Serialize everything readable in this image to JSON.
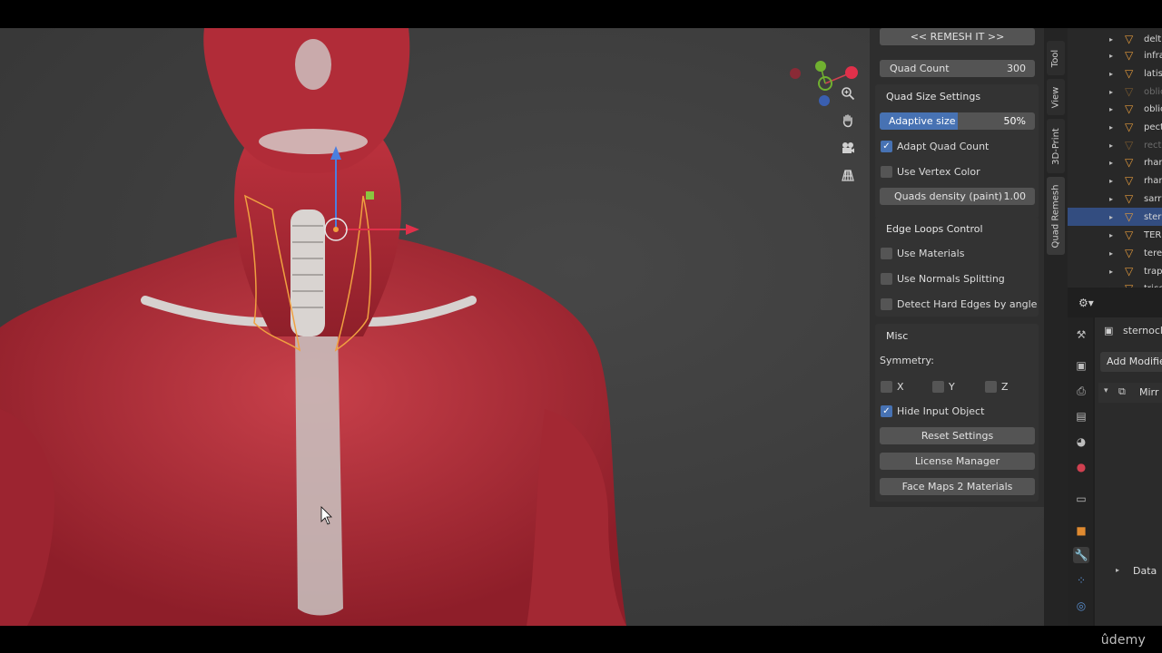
{
  "watermark": "ûdemy",
  "npanel": {
    "remesh_button": "<< REMESH IT >>",
    "quad_count": {
      "label": "Quad Count",
      "value": "300"
    },
    "quad_size": {
      "title": "Quad Size Settings",
      "adaptive": {
        "label": "Adaptive size",
        "value": "50%",
        "fraction": 0.5
      },
      "adapt_quad_count": {
        "label": "Adapt Quad Count",
        "checked": true
      },
      "use_vertex_color": {
        "label": "Use Vertex Color",
        "checked": false
      },
      "quads_density": {
        "label": "Quads density (paint)",
        "value": "1.00"
      }
    },
    "edge_loops": {
      "title": "Edge Loops Control",
      "use_materials": {
        "label": "Use Materials",
        "checked": false
      },
      "use_normals": {
        "label": "Use Normals Splitting",
        "checked": false
      },
      "detect_hard": {
        "label": "Detect Hard Edges by angle",
        "checked": false
      }
    },
    "misc": {
      "title": "Misc",
      "symmetry_label": "Symmetry:",
      "sym_x": "X",
      "sym_y": "Y",
      "sym_z": "Z",
      "hide_input": {
        "label": "Hide Input Object",
        "checked": true
      },
      "reset": "Reset Settings",
      "license": "License Manager",
      "face_maps": "Face Maps 2 Materials"
    }
  },
  "vtabs": [
    "Tool",
    "View",
    "3D-Print",
    "Quad Remesh"
  ],
  "outliner": [
    {
      "name": "delt",
      "state": "normal"
    },
    {
      "name": "infra",
      "state": "normal"
    },
    {
      "name": "latis",
      "state": "normal"
    },
    {
      "name": "oblic",
      "state": "dim"
    },
    {
      "name": "oblic",
      "state": "normal"
    },
    {
      "name": "pect",
      "state": "normal"
    },
    {
      "name": "rect",
      "state": "dim"
    },
    {
      "name": "rhar",
      "state": "normal"
    },
    {
      "name": "rhar",
      "state": "normal"
    },
    {
      "name": "sarr",
      "state": "normal"
    },
    {
      "name": "ster",
      "state": "selected"
    },
    {
      "name": "TER",
      "state": "normal"
    },
    {
      "name": "tere",
      "state": "normal"
    },
    {
      "name": "trap",
      "state": "normal"
    },
    {
      "name": "trice",
      "state": "normal"
    }
  ],
  "properties": {
    "object_name": "sternocl",
    "add_modifier": "Add Modifier",
    "modifier_name": "Mirr",
    "data_label": "Data"
  },
  "icons": {
    "zoom": "zoom-icon",
    "hand": "pan-icon",
    "camera": "camera-icon",
    "grid": "grid-icon"
  },
  "colors": {
    "accent": "#4772b3",
    "muscle": "#b32a36",
    "selection": "#e39a3c"
  }
}
